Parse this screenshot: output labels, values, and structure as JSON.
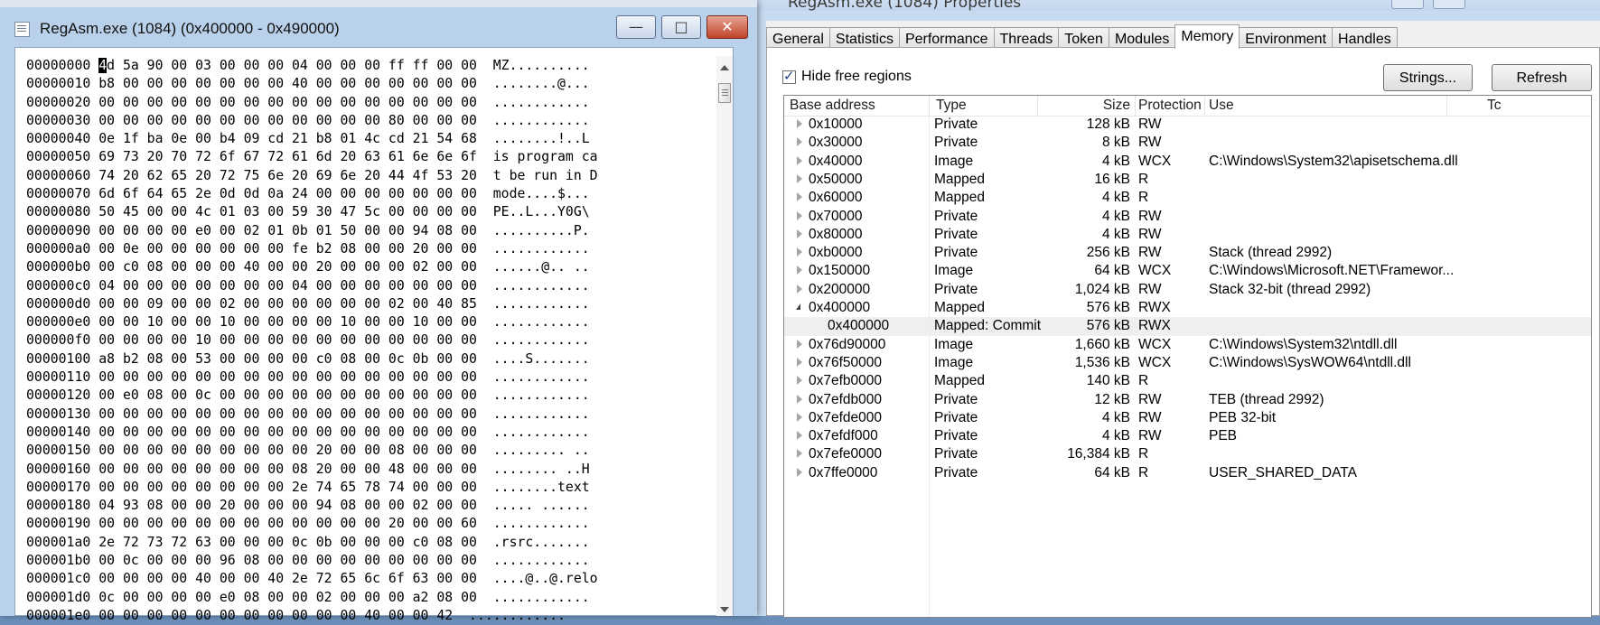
{
  "hex_window": {
    "title": "RegAsm.exe (1084) (0x400000 - 0x490000)",
    "buttons": {
      "minimize": "—",
      "maximize": "□",
      "close": "✕"
    },
    "caret_char": "4",
    "lines": [
      {
        "addr": "00000000",
        "pre": "",
        "caret": "4",
        "hex": "d 5a 90 00 03 00 00 00 04 00 00 00 ff ff 00 00",
        "ascii": "MZ.........."
      },
      {
        "addr": "00000010",
        "pre": "b",
        "caret": "",
        "hex": "8 00 00 00 00 00 00 00 40 00 00 00 00 00 00 00",
        "ascii": "........@..."
      },
      {
        "addr": "00000020",
        "pre": "0",
        "caret": "",
        "hex": "0 00 00 00 00 00 00 00 00 00 00 00 00 00 00 00",
        "ascii": "............"
      },
      {
        "addr": "00000030",
        "pre": "0",
        "caret": "",
        "hex": "0 00 00 00 00 00 00 00 00 00 00 00 80 00 00 00",
        "ascii": "............"
      },
      {
        "addr": "00000040",
        "pre": "0",
        "caret": "",
        "hex": "e 1f ba 0e 00 b4 09 cd 21 b8 01 4c cd 21 54 68",
        "ascii": "........!..L"
      },
      {
        "addr": "00000050",
        "pre": "6",
        "caret": "",
        "hex": "9 73 20 70 72 6f 67 72 61 6d 20 63 61 6e 6e 6f",
        "ascii": "is program ca"
      },
      {
        "addr": "00000060",
        "pre": "7",
        "caret": "",
        "hex": "4 20 62 65 20 72 75 6e 20 69 6e 20 44 4f 53 20",
        "ascii": "t be run in D"
      },
      {
        "addr": "00000070",
        "pre": "6",
        "caret": "",
        "hex": "d 6f 64 65 2e 0d 0d 0a 24 00 00 00 00 00 00 00",
        "ascii": "mode....$..."
      },
      {
        "addr": "00000080",
        "pre": "5",
        "caret": "",
        "hex": "0 45 00 00 4c 01 03 00 59 30 47 5c 00 00 00 00",
        "ascii": "PE..L...Y0G\\"
      },
      {
        "addr": "00000090",
        "pre": "0",
        "caret": "",
        "hex": "0 00 00 00 e0 00 02 01 0b 01 50 00 00 94 08 00",
        "ascii": "..........P."
      },
      {
        "addr": "000000a0",
        "pre": "0",
        "caret": "",
        "hex": "0 0e 00 00 00 00 00 00 fe b2 08 00 00 20 00 00",
        "ascii": "............"
      },
      {
        "addr": "000000b0",
        "pre": "0",
        "caret": "",
        "hex": "0 c0 08 00 00 00 40 00 00 20 00 00 00 02 00 00",
        "ascii": "......@.. .."
      },
      {
        "addr": "000000c0",
        "pre": "0",
        "caret": "",
        "hex": "4 00 00 00 00 00 00 00 04 00 00 00 00 00 00 00",
        "ascii": "............"
      },
      {
        "addr": "000000d0",
        "pre": "0",
        "caret": "",
        "hex": "0 00 09 00 00 02 00 00 00 00 00 00 02 00 40 85",
        "ascii": "............"
      },
      {
        "addr": "000000e0",
        "pre": "0",
        "caret": "",
        "hex": "0 00 10 00 00 10 00 00 00 00 10 00 00 10 00 00",
        "ascii": "............"
      },
      {
        "addr": "000000f0",
        "pre": "0",
        "caret": "",
        "hex": "0 00 00 00 10 00 00 00 00 00 00 00 00 00 00 00",
        "ascii": "............"
      },
      {
        "addr": "00000100",
        "pre": "a",
        "caret": "",
        "hex": "8 b2 08 00 53 00 00 00 00 c0 08 00 0c 0b 00 00",
        "ascii": "....S......."
      },
      {
        "addr": "00000110",
        "pre": "0",
        "caret": "",
        "hex": "0 00 00 00 00 00 00 00 00 00 00 00 00 00 00 00",
        "ascii": "............"
      },
      {
        "addr": "00000120",
        "pre": "0",
        "caret": "",
        "hex": "0 e0 08 00 0c 00 00 00 00 00 00 00 00 00 00 00",
        "ascii": "............"
      },
      {
        "addr": "00000130",
        "pre": "0",
        "caret": "",
        "hex": "0 00 00 00 00 00 00 00 00 00 00 00 00 00 00 00",
        "ascii": "............"
      },
      {
        "addr": "00000140",
        "pre": "0",
        "caret": "",
        "hex": "0 00 00 00 00 00 00 00 00 00 00 00 00 00 00 00",
        "ascii": "............"
      },
      {
        "addr": "00000150",
        "pre": "0",
        "caret": "",
        "hex": "0 00 00 00 00 00 00 00 00 20 00 00 08 00 00 00",
        "ascii": "......... .."
      },
      {
        "addr": "00000160",
        "pre": "0",
        "caret": "",
        "hex": "0 00 00 00 00 00 00 00 08 20 00 00 48 00 00 00",
        "ascii": "........ ..H"
      },
      {
        "addr": "00000170",
        "pre": "0",
        "caret": "",
        "hex": "0 00 00 00 00 00 00 00 2e 74 65 78 74 00 00 00",
        "ascii": "........text"
      },
      {
        "addr": "00000180",
        "pre": "0",
        "caret": "",
        "hex": "4 93 08 00 00 20 00 00 00 94 08 00 00 02 00 00",
        "ascii": "..... ......"
      },
      {
        "addr": "00000190",
        "pre": "0",
        "caret": "",
        "hex": "0 00 00 00 00 00 00 00 00 00 00 00 20 00 00 60",
        "ascii": "............"
      },
      {
        "addr": "000001a0",
        "pre": "2",
        "caret": "",
        "hex": "e 72 73 72 63 00 00 00 0c 0b 00 00 00 c0 08 00",
        "ascii": ".rsrc......."
      },
      {
        "addr": "000001b0",
        "pre": "0",
        "caret": "",
        "hex": "0 0c 00 00 00 96 08 00 00 00 00 00 00 00 00 00",
        "ascii": "............"
      },
      {
        "addr": "000001c0",
        "pre": "0",
        "caret": "",
        "hex": "0 00 00 00 40 00 00 40 2e 72 65 6c 6f 63 00 00",
        "ascii": "....@..@.relo"
      },
      {
        "addr": "000001d0",
        "pre": "0",
        "caret": "",
        "hex": "c 00 00 00 00 e0 08 00 00 02 00 00 00 a2 08 00",
        "ascii": "............"
      },
      {
        "addr": "000001e0",
        "pre": "0",
        "caret": "",
        "hex": "0 00 00 00 00 00 00 00 00 00 00 40 00 00 42",
        "ascii": "............"
      }
    ]
  },
  "props_window": {
    "title": "RegAsm.exe (1084) Properties",
    "tabs": [
      "General",
      "Statistics",
      "Performance",
      "Threads",
      "Token",
      "Modules",
      "Memory",
      "Environment",
      "Handles"
    ],
    "active_tab": "Memory",
    "hide_free_label": "Hide free regions",
    "strings_button": "Strings...",
    "refresh_button": "Refresh",
    "columns": [
      "Base address",
      "Type",
      "Size",
      "Protection",
      "Use",
      "Tc"
    ],
    "rows": [
      {
        "base": "0x10000",
        "type": "Private",
        "size": "128 kB",
        "prot": "RW",
        "use": ""
      },
      {
        "base": "0x30000",
        "type": "Private",
        "size": "8 kB",
        "prot": "RW",
        "use": ""
      },
      {
        "base": "0x40000",
        "type": "Image",
        "size": "4 kB",
        "prot": "WCX",
        "use": "C:\\Windows\\System32\\apisetschema.dll"
      },
      {
        "base": "0x50000",
        "type": "Mapped",
        "size": "16 kB",
        "prot": "R",
        "use": ""
      },
      {
        "base": "0x60000",
        "type": "Mapped",
        "size": "4 kB",
        "prot": "R",
        "use": ""
      },
      {
        "base": "0x70000",
        "type": "Private",
        "size": "4 kB",
        "prot": "RW",
        "use": ""
      },
      {
        "base": "0x80000",
        "type": "Private",
        "size": "4 kB",
        "prot": "RW",
        "use": ""
      },
      {
        "base": "0xb0000",
        "type": "Private",
        "size": "256 kB",
        "prot": "RW",
        "use": "Stack (thread 2992)"
      },
      {
        "base": "0x150000",
        "type": "Image",
        "size": "64 kB",
        "prot": "WCX",
        "use": "C:\\Windows\\Microsoft.NET\\Framewor..."
      },
      {
        "base": "0x200000",
        "type": "Private",
        "size": "1,024 kB",
        "prot": "RW",
        "use": "Stack 32-bit (thread 2992)"
      },
      {
        "base": "0x400000",
        "type": "Mapped",
        "size": "576 kB",
        "prot": "RWX",
        "use": "",
        "expanded": true
      },
      {
        "base": "0x400000",
        "type": "Mapped: Commit",
        "size": "576 kB",
        "prot": "RWX",
        "use": "",
        "child": true
      },
      {
        "base": "0x76d90000",
        "type": "Image",
        "size": "1,660 kB",
        "prot": "WCX",
        "use": "C:\\Windows\\System32\\ntdll.dll"
      },
      {
        "base": "0x76f50000",
        "type": "Image",
        "size": "1,536 kB",
        "prot": "WCX",
        "use": "C:\\Windows\\SysWOW64\\ntdll.dll"
      },
      {
        "base": "0x7efb0000",
        "type": "Mapped",
        "size": "140 kB",
        "prot": "R",
        "use": ""
      },
      {
        "base": "0x7efdb000",
        "type": "Private",
        "size": "12 kB",
        "prot": "RW",
        "use": "TEB (thread 2992)"
      },
      {
        "base": "0x7efde000",
        "type": "Private",
        "size": "4 kB",
        "prot": "RW",
        "use": "PEB 32-bit"
      },
      {
        "base": "0x7efdf000",
        "type": "Private",
        "size": "4 kB",
        "prot": "RW",
        "use": "PEB"
      },
      {
        "base": "0x7efe0000",
        "type": "Private",
        "size": "16,384 kB",
        "prot": "R",
        "use": ""
      },
      {
        "base": "0x7ffe0000",
        "type": "Private",
        "size": "64 kB",
        "prot": "R",
        "use": "USER_SHARED_DATA"
      }
    ]
  }
}
